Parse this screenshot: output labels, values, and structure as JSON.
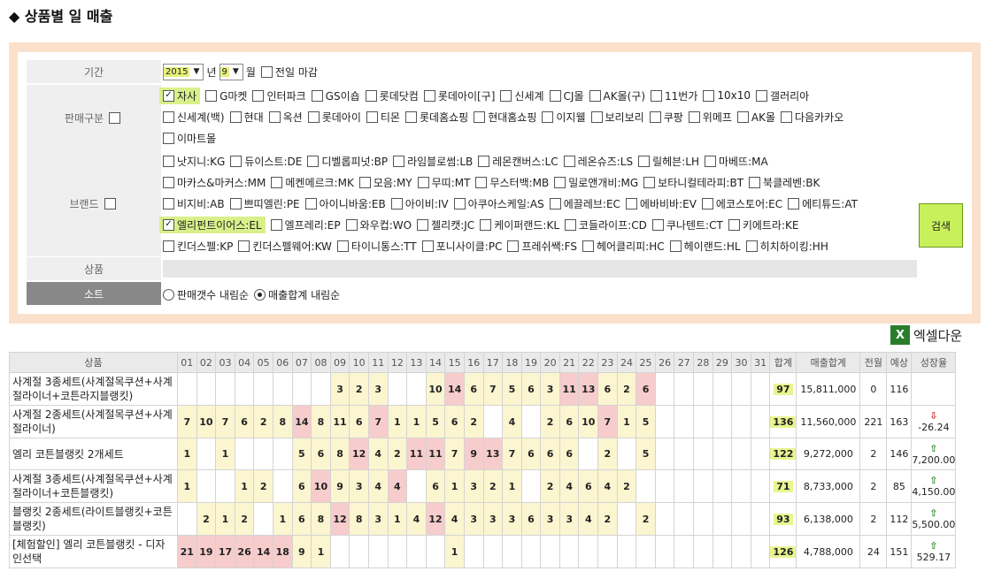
{
  "page": {
    "title": "◆ 상품별 일 매출"
  },
  "filter": {
    "period_label": "기간",
    "year": "2015",
    "year_unit": "년",
    "month": "9",
    "month_unit": "월",
    "prev_month_close": "전일 마감",
    "sales_label": "판매구분",
    "sales_channels": [
      [
        "자사",
        "G마켓",
        "인터파크",
        "GS이숍",
        "롯데닷컴",
        "롯데아이[구]",
        "신세계",
        "CJ몰",
        "AK몰(구)",
        "11번가",
        "10x10",
        "갤러리아"
      ],
      [
        "신세계(백)",
        "현대",
        "옥션",
        "롯데아이",
        "티몬",
        "롯데홈쇼핑",
        "현대홈쇼핑",
        "이지웰",
        "보리보리",
        "쿠팡",
        "위메프",
        "AK몰",
        "다음카카오"
      ],
      [
        "이마트몰"
      ]
    ],
    "brand_label": "브랜드",
    "brands": [
      [
        "낫지니:KG",
        "듀이스트:DE",
        "디벨롭피넛:BP",
        "라임블로썸:LB",
        "레몬캔버스:LC",
        "레온슈즈:LS",
        "릴헤븐:LH",
        "마베뜨:MA"
      ],
      [
        "마카스&마커스:MM",
        "메켄메르크:MK",
        "모음:MY",
        "무띠:MT",
        "무스터백:MB",
        "밀로앤개비:MG",
        "보타니컬테라피:BT",
        "북클레벤:BK"
      ],
      [
        "비지비:AB",
        "쁘띠엘린:PE",
        "아이니바움:EB",
        "아이비:IV",
        "아쿠아스케일:AS",
        "에끌레브:EC",
        "에바비바:EV",
        "에코스토어:EC",
        "에티튜드:AT"
      ],
      [
        "엘리펀트이어스:EL",
        "엘프레리:EP",
        "와우컵:WO",
        "젤리캣:JC",
        "케이퍼랜드:KL",
        "코들라이프:CD",
        "쿠나텐트:CT",
        "키에트라:KE"
      ],
      [
        "킨더스펠:KP",
        "킨더스펠웨어:KW",
        "타이니통스:TT",
        "포니사이클:PC",
        "프레쉬쌕:FS",
        "헤어클리피:HC",
        "헤이랜드:HL",
        "히치하이킹:HH"
      ]
    ],
    "product_label": "상품",
    "sort_label": "소트",
    "sort_options": [
      "판매갯수 내림순",
      "매출합계 내림순"
    ],
    "search_button": "검색"
  },
  "excel_download": "엑셀다운",
  "table": {
    "headers": {
      "product": "상품",
      "total": "합계",
      "revenue": "매출합계",
      "prev_month": "전월",
      "forecast": "예상",
      "growth": "성장율"
    },
    "days": [
      "01",
      "02",
      "03",
      "04",
      "05",
      "06",
      "07",
      "08",
      "09",
      "10",
      "11",
      "12",
      "13",
      "14",
      "15",
      "16",
      "17",
      "18",
      "19",
      "20",
      "21",
      "22",
      "23",
      "24",
      "25",
      "26",
      "27",
      "28",
      "29",
      "30",
      "31"
    ],
    "rows": [
      {
        "name": "사계절 3종세트(사계절목쿠션+사계절라이너+코튼라지블랭킷)",
        "daily": [
          "",
          "",
          "",
          "",
          "",
          "",
          "",
          "",
          "3",
          "2",
          "3",
          "",
          "",
          "10",
          "14",
          "6",
          "7",
          "5",
          "6",
          "3",
          "11",
          "13",
          "6",
          "2",
          "6",
          "",
          "",
          "",
          "",
          "",
          ""
        ],
        "total": "97",
        "revenue": "15,811,000",
        "prev": "0",
        "forecast": "116",
        "growth": "",
        "growth_dir": ""
      },
      {
        "name": "사계절 2종세트(사계절목쿠션+사계절라이너)",
        "daily": [
          "7",
          "10",
          "7",
          "6",
          "2",
          "8",
          "14",
          "8",
          "11",
          "6",
          "7",
          "1",
          "1",
          "5",
          "6",
          "2",
          "",
          "4",
          "",
          "2",
          "6",
          "10",
          "7",
          "1",
          "5",
          "",
          "",
          "",
          "",
          "",
          ""
        ],
        "total": "136",
        "revenue": "11,560,000",
        "prev": "221",
        "forecast": "163",
        "growth": "-26.24",
        "growth_dir": "down"
      },
      {
        "name": "엘리 코튼블랭킷 2개세트",
        "daily": [
          "1",
          "",
          "1",
          "",
          "",
          "",
          "5",
          "6",
          "8",
          "12",
          "4",
          "2",
          "11",
          "11",
          "7",
          "9",
          "13",
          "7",
          "6",
          "6",
          "6",
          "",
          "2",
          "",
          "5",
          "",
          "",
          "",
          "",
          "",
          ""
        ],
        "total": "122",
        "revenue": "9,272,000",
        "prev": "2",
        "forecast": "146",
        "growth": "7,200.00",
        "growth_dir": "up"
      },
      {
        "name": "사계절 3종세트(사계절목쿠션+사계절라이너+코튼블랭킷)",
        "daily": [
          "1",
          "",
          "",
          "1",
          "2",
          "",
          "6",
          "10",
          "9",
          "3",
          "4",
          "4",
          "",
          "6",
          "1",
          "3",
          "2",
          "1",
          "",
          "2",
          "4",
          "6",
          "4",
          "2",
          "",
          "",
          "",
          "",
          "",
          "",
          ""
        ],
        "total": "71",
        "revenue": "8,733,000",
        "prev": "2",
        "forecast": "85",
        "growth": "4,150.00",
        "growth_dir": "up"
      },
      {
        "name": "블랭킷 2종세트(라이트블랭킷+코튼블랭킷)",
        "daily": [
          "",
          "2",
          "1",
          "2",
          "",
          "1",
          "6",
          "8",
          "12",
          "8",
          "3",
          "1",
          "4",
          "12",
          "4",
          "3",
          "3",
          "3",
          "6",
          "3",
          "3",
          "4",
          "2",
          "",
          "2",
          "",
          "",
          "",
          "",
          "",
          ""
        ],
        "total": "93",
        "revenue": "6,138,000",
        "prev": "2",
        "forecast": "112",
        "growth": "5,500.00",
        "growth_dir": "up"
      },
      {
        "name": "[체험할인] 엘리 코튼블랭킷 - 디자인선택",
        "daily": [
          "21",
          "19",
          "17",
          "26",
          "14",
          "18",
          "9",
          "1",
          "",
          "",
          "",
          "",
          "",
          "",
          "1",
          "",
          "",
          "",
          "",
          "",
          "",
          "",
          "",
          "",
          "",
          "",
          "",
          "",
          "",
          "",
          ""
        ],
        "total": "126",
        "revenue": "4,788,000",
        "prev": "24",
        "forecast": "151",
        "growth": "529.17",
        "growth_dir": "up"
      }
    ]
  }
}
